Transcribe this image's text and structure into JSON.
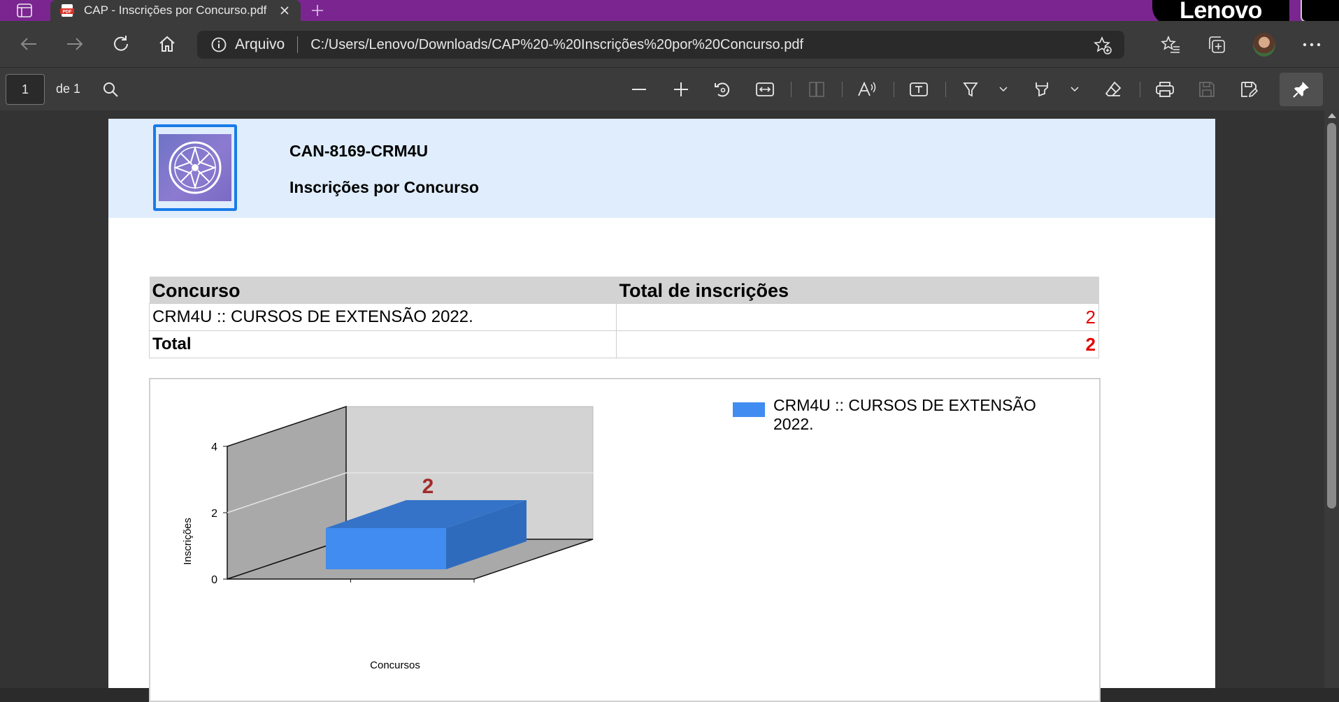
{
  "browser": {
    "tab_title": "CAP - Inscrições por Concurso.pdf",
    "brand": "Lenovo",
    "address_origin": "Arquivo",
    "address_url": "C:/Users/Lenovo/Downloads/CAP%20-%20Inscrições%20por%20Concurso.pdf"
  },
  "pdf_toolbar": {
    "page_current": "1",
    "page_total_label": "de 1"
  },
  "document": {
    "code": "CAN-8169-CRM4U",
    "title": "Inscrições por Concurso",
    "table": {
      "headers": [
        "Concurso",
        "Total de inscrições"
      ],
      "rows": [
        {
          "concurso": "CRM4U :: CURSOS DE EXTENSÃO 2022.",
          "total": "2"
        }
      ],
      "total_row": {
        "label": "Total",
        "value": "2"
      }
    }
  },
  "colors": {
    "tabstrip": "#7b2591",
    "accent": "#1a7be8",
    "number_red": "#e40000",
    "bar": "#418cf0"
  },
  "chart_data": {
    "type": "bar",
    "categories": [
      ""
    ],
    "series": [
      {
        "name": "CRM4U :: CURSOS DE EXTENSÃO 2022.",
        "values": [
          2
        ]
      }
    ],
    "data_labels": [
      "2"
    ],
    "xlabel": "Concursos",
    "ylabel": "Inscrições",
    "ylim": [
      0,
      4
    ],
    "yticks": [
      0,
      2,
      4
    ],
    "grid": true,
    "legend": "right",
    "style": "3d"
  }
}
